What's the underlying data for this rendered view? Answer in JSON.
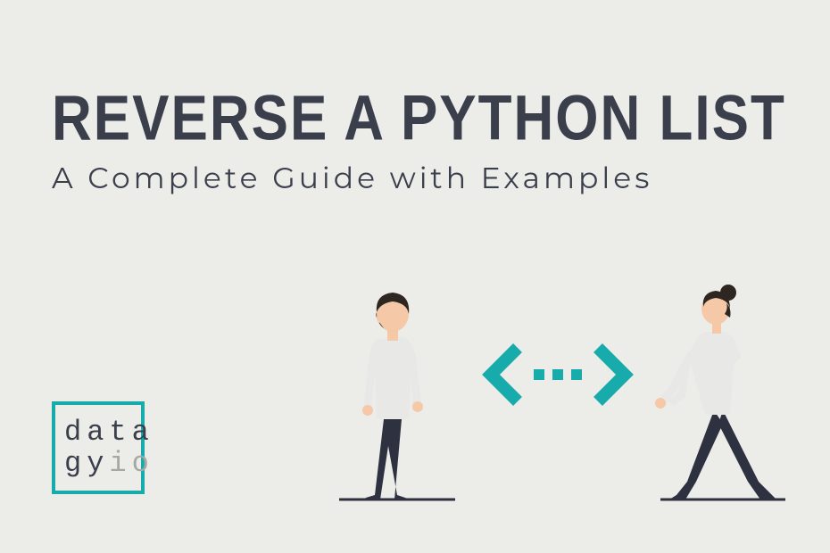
{
  "title": "REVERSE A PYTHON LIST",
  "subtitle": "A Complete Guide with Examples",
  "logo": {
    "line1": "data",
    "line2_a": "gy",
    "line2_b": "io"
  },
  "colors": {
    "accent": "#18abac",
    "text": "#3a3f4b",
    "muted": "#a7a7a3",
    "background": "#ecece9"
  }
}
